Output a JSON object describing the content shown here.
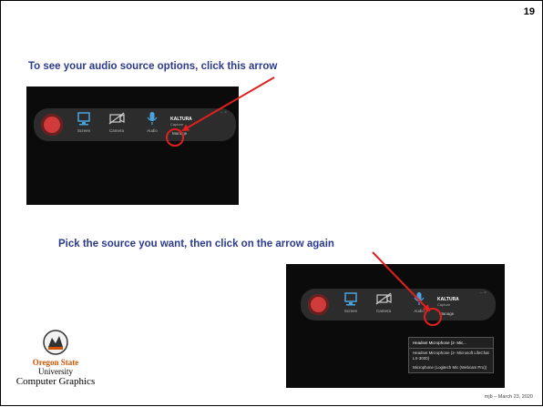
{
  "slide": {
    "number": "19",
    "caption_top": "To see your audio source options, click this arrow",
    "caption_bottom": "Pick the source you want, then click on the arrow again",
    "footer": "mjb – March 23, 2020",
    "logo": {
      "name": "Oregon State",
      "university": "University",
      "department": "Computer Graphics"
    }
  },
  "recorder": {
    "controls": {
      "screen": {
        "label": "Screen",
        "icon": "monitor-icon"
      },
      "camera": {
        "label": "Camera",
        "icon": "camera-off-icon"
      },
      "audio": {
        "label": "Audio",
        "icon": "microphone-icon"
      }
    },
    "brand": "KALTURA",
    "brand_sub": "Capture",
    "manage": "Manage"
  },
  "audio_dropdown": {
    "selected": "Headset Microphone (2- Mic...",
    "options": [
      "Headset Microphone (2- Microsoft LifeChat LX-3000)",
      "Microphone (Logitech Mic (Webcam Pro))"
    ]
  },
  "colors": {
    "caption": "#2b3a8c",
    "arrow": "#e02020",
    "record": "#d23b3b",
    "icon_blue": "#4aa3df",
    "osu_orange": "#d35400"
  }
}
